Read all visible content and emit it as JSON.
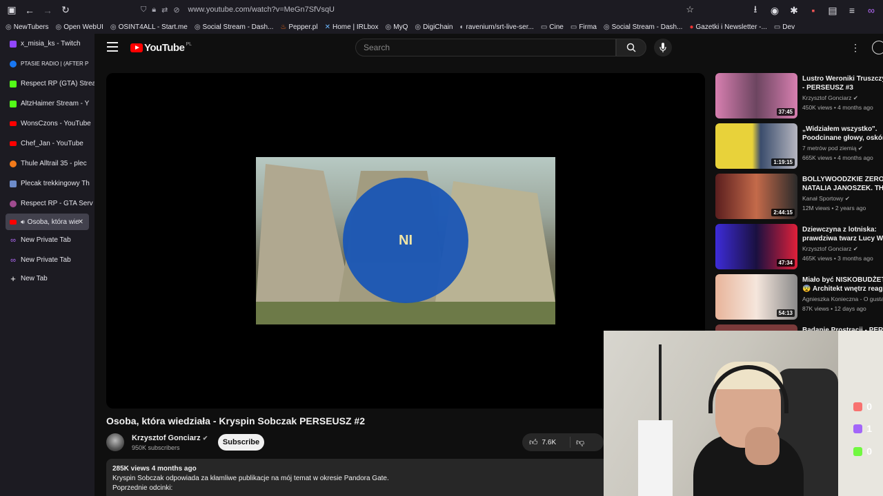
{
  "browser": {
    "url": "www.youtube.com/watch?v=MeGn7SfVsqU",
    "bookmarks": [
      "NewTubers",
      "Open WebUI",
      "OSINT4ALL - Start.me",
      "Social Stream - Dash...",
      "Pepper.pl",
      "Home | IRLbox",
      "MyQ",
      "DigiChain",
      "ravenium/srt-live-ser...",
      "Cine",
      "Firma",
      "Social Stream - Dash...",
      "Gazetki i Newsletter -...",
      "Dev"
    ],
    "tabs": [
      {
        "label": "x_misia_ks - Twitch",
        "color": "#9146ff"
      },
      {
        "label": "PTASIE RADIO | (AFTER P",
        "color": "#1877f2"
      },
      {
        "label": "Respect RP (GTA) Strea",
        "color": "#53fc18"
      },
      {
        "label": "AltzHaimer Stream - Y",
        "color": "#53fc18"
      },
      {
        "label": "WonsCzons - YouTube",
        "color": "#ff0000"
      },
      {
        "label": "Chef_Jan - YouTube",
        "color": "#ff0000"
      },
      {
        "label": "Thule Alltrail 35 - plec",
        "color": "#f27a1a"
      },
      {
        "label": "Plecak trekkingowy Th",
        "color": "#6d8bc9"
      },
      {
        "label": "Respect RP - GTA Serv",
        "color": "#a04b8f"
      },
      {
        "label": "Osoba, która wie",
        "color": "#ff0000",
        "active": true
      },
      {
        "label": "New Private Tab",
        "color": "#8f3cf5"
      },
      {
        "label": "New Private Tab",
        "color": "#8f3cf5"
      },
      {
        "label": "New Tab",
        "color": "none"
      }
    ]
  },
  "youtube": {
    "logo_text": "YouTube",
    "country": "PL",
    "search_placeholder": "Search",
    "player_overlay_text": "NI",
    "video_title": "Osoba, która wiedziała - Kryspin Sobczak PERSEUSZ #2",
    "channel_name": "Krzysztof Gonciarz",
    "channel_subs": "950K subscribers",
    "subscribe_label": "Subscribe",
    "likes": "7.6K",
    "description_meta": "285K views  4 months ago",
    "description_line1": "Kryspin Sobczak odpowiada za kłamliwe publikacje na mój temat w okresie Pandora Gate.",
    "description_line2": "Poprzednie odcinki:",
    "recommendations": [
      {
        "title1": "Lustro Weroniki Truszczyń",
        "title2": "- PERSEUSZ #3",
        "channel": "Krzysztof Gonciarz",
        "meta": "450K views • 4 months ago",
        "duration": "37:45",
        "bg": "#c86fa0"
      },
      {
        "title1": "„Widziałem wszystko\".",
        "title2": "Poodcinane głowy, oskóro",
        "channel": "7 metrów pod ziemią",
        "meta": "665K views • 4 months ago",
        "duration": "1:19:15",
        "bg": "#e8d23a"
      },
      {
        "title1": "BOLLYWOODZKIE ZERO:",
        "title2": "NATALIA JANOSZEK. THE",
        "channel": "Kanał Sportowy",
        "meta": "12M views • 2 years ago",
        "duration": "2:44:15",
        "bg": "#8a2a2a"
      },
      {
        "title1": "Dziewczyna z lotniska:",
        "title2": "prawdziwa twarz Lucy Wie",
        "channel": "Krzysztof Gonciarz",
        "meta": "465K views • 3 months ago",
        "duration": "47:34",
        "bg": "#4a2cc9"
      },
      {
        "title1": "Miało być NISKOBUDŻETO",
        "title2": "😨 Architekt wnętrz reaguj",
        "channel": "Agnieszka Konieczna - O gustac",
        "meta": "87K views • 12 days ago",
        "duration": "54:13",
        "bg": "#d9a08a"
      },
      {
        "title1": "Badanie Prostracji - PERSE",
        "title2": "",
        "channel": "",
        "meta": "",
        "duration": "",
        "bg": "#7a3a3a"
      }
    ]
  },
  "webcam": {
    "counters": [
      "0",
      "1",
      "0"
    ]
  }
}
